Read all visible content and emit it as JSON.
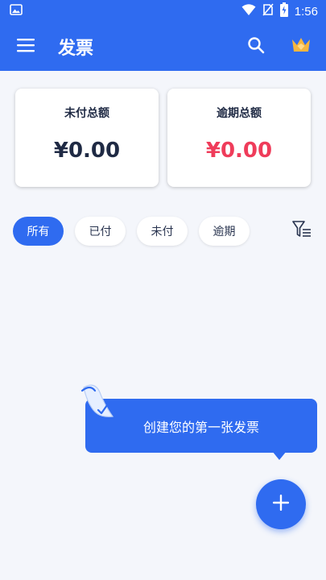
{
  "status_bar": {
    "time": "1:56",
    "icons": [
      "image-icon",
      "wifi-icon",
      "no-sim-icon",
      "battery-charging-icon"
    ]
  },
  "app_bar": {
    "title": "发票",
    "icons": [
      "menu-icon",
      "search-icon",
      "crown-icon"
    ]
  },
  "summary": {
    "unpaid_label": "未付总额",
    "unpaid_value": "¥0.00",
    "overdue_label": "逾期总额",
    "overdue_value": "¥0.00"
  },
  "filters": {
    "chips": [
      {
        "label": "所有",
        "active": true
      },
      {
        "label": "已付",
        "active": false
      },
      {
        "label": "未付",
        "active": false
      },
      {
        "label": "逾期",
        "active": false
      }
    ],
    "filter_icon": "filter-list-icon"
  },
  "empty_state": {
    "hint": "创建您的第一张发票"
  },
  "fab": {
    "icon": "plus-icon"
  },
  "colors": {
    "primary": "#2f6bf0",
    "overdue": "#ef3c5a",
    "text_dark": "#1f2a44",
    "background": "#f4f6fb",
    "crown": "#f5b540"
  }
}
